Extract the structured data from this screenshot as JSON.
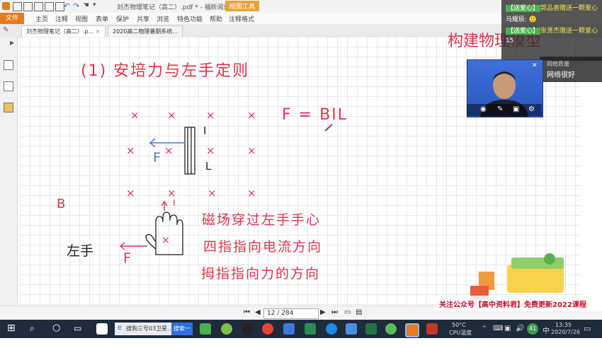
{
  "titlebar": {
    "title": "刘杰物理笔记（高二）.pdf * - 福昕阅读器",
    "tool_tab": "绘图工具"
  },
  "ribbon": {
    "file": "文件",
    "menus": [
      "主页",
      "注释",
      "视图",
      "表单",
      "保护",
      "共享",
      "浏览",
      "特色功能",
      "帮助",
      "注释格式"
    ]
  },
  "tabs": [
    {
      "label": "刘杰物理笔记（高二）.p..."
    },
    {
      "label": "2020高二物理暑期系统..."
    }
  ],
  "notes": {
    "heading": "(1) 安培力与左手定则",
    "formula": "F = BIL",
    "field_symbol": "×",
    "label_I": "I",
    "label_L": "L",
    "label_F": "F",
    "label_B": "B",
    "label_I2": "I",
    "label_F2": "F",
    "left_hand": "左手",
    "rule_lines": [
      "磁场穿过左手手心",
      "四指指向电流方向",
      "拇指指向力的方向"
    ],
    "partial_text": "构建物理模型"
  },
  "chat": {
    "line1_badge": "【送爱心】",
    "line1_text": "郭品喜赠送一颗爱心",
    "line2_text": "马耀辰: 🙂",
    "line3_badge": "【送爱心】",
    "line3_text": "张贤杰赠送一颗爱心",
    "line4_text": "15"
  },
  "network": {
    "label": "网络质量",
    "value": "网络很好"
  },
  "navigation": {
    "page_display": "12 / 284"
  },
  "promo": "关注公众号【高中资料君】免费更新2022课程",
  "taskbar": {
    "search_text": "搜狗三号03卫星...",
    "search_button": "搜索一下",
    "temp": "50°C",
    "cpu_label": "CPU温度",
    "ime": "中",
    "time": "13:35",
    "date": "2020/7/26",
    "notif_count": "41"
  },
  "colors": {
    "ink_red": "#e0364a",
    "ink_blue": "#4a7ccf",
    "ink_black": "#222222",
    "accent_orange": "#e57c1e"
  }
}
